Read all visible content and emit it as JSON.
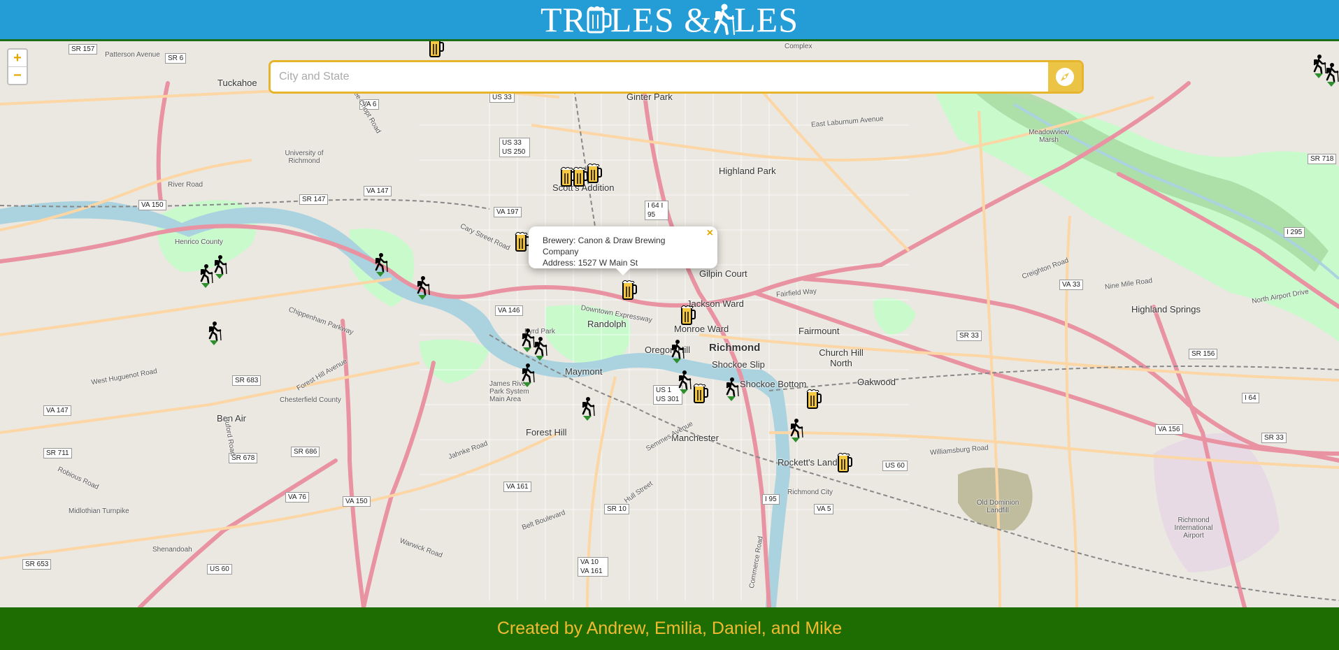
{
  "header": {
    "title_part1": "TR",
    "title_part2": "LES &",
    "title_part3": "LES"
  },
  "search": {
    "placeholder": "City and State",
    "button_icon": "compass-icon"
  },
  "zoom": {
    "in_label": "+",
    "out_label": "−"
  },
  "popup": {
    "line1": "Brewery: Canon & Draw Brewing Company",
    "line2": "Address: 1527 W Main St",
    "close_label": "×"
  },
  "map": {
    "place_labels": [
      {
        "name": "Tuckahoe",
        "style": "mid"
      },
      {
        "name": "University of Richmond",
        "style": "small"
      },
      {
        "name": "Ginter Park",
        "style": "mid"
      },
      {
        "name": "Highland Park",
        "style": "mid"
      },
      {
        "name": "Scott's Addition",
        "style": "mid"
      },
      {
        "name": "Gilpin Court",
        "style": "mid"
      },
      {
        "name": "Jackson Ward",
        "style": "mid"
      },
      {
        "name": "Monroe Ward",
        "style": "mid"
      },
      {
        "name": "Randolph",
        "style": "mid"
      },
      {
        "name": "Richmond",
        "style": "big"
      },
      {
        "name": "Shockoe Slip",
        "style": "mid"
      },
      {
        "name": "Shockoe Bottom",
        "style": "mid"
      },
      {
        "name": "Church Hill North",
        "style": "mid"
      },
      {
        "name": "Fairmount",
        "style": "mid"
      },
      {
        "name": "Oakwood",
        "style": "mid"
      },
      {
        "name": "Highland Springs",
        "style": "mid"
      },
      {
        "name": "Maymont",
        "style": "mid"
      },
      {
        "name": "Forest Hill",
        "style": "mid"
      },
      {
        "name": "Manchester",
        "style": "mid"
      },
      {
        "name": "Rockett's Landing",
        "style": "mid"
      },
      {
        "name": "Bon Air",
        "style": "mid"
      },
      {
        "name": "Oregon Hill",
        "style": "mid"
      },
      {
        "name": "Meadowview Marsh",
        "style": "small"
      },
      {
        "name": "Old Dominion Landfill",
        "style": "small"
      },
      {
        "name": "Richmond International Airport",
        "style": "small"
      },
      {
        "name": "Shenandoah",
        "style": "small"
      },
      {
        "name": "Byrd Park",
        "style": "small"
      },
      {
        "name": "James River Park System Main Area",
        "style": "small"
      },
      {
        "name": "Chesterfield County",
        "style": "small"
      },
      {
        "name": "Richmond City",
        "style": "small"
      },
      {
        "name": "Henrico County",
        "style": "small"
      },
      {
        "name": "Complex",
        "style": "small"
      }
    ],
    "shields": [
      "SR 157",
      "SR 6",
      "US 33",
      "VA 6",
      "US 33 US 250",
      "VA 147",
      "SR 147",
      "VA 150",
      "VA 197",
      "I 64 I 95",
      "VA 146",
      "US 1 US 301",
      "SR 683",
      "VA 147",
      "SR 711",
      "SR 678",
      "SR 686",
      "VA 76",
      "VA 150",
      "US 60",
      "SR 653",
      "VA 161",
      "SR 10",
      "VA 10 VA 161",
      "I 95",
      "VA 5",
      "US 60",
      "SR 33",
      "SR 156",
      "VA 33",
      "I 64",
      "VA 156",
      "SR 33",
      "I 295",
      "SR 718"
    ],
    "road_labels": [
      "Patterson Avenue",
      "River Road",
      "Three Chopt Road",
      "Cary Street Road",
      "Chippenham Parkway",
      "Forest Hill Avenue",
      "West Huguenot Road",
      "Midlothian Turnpike",
      "Jahnke Road",
      "Hull Street",
      "Semmes Avenue",
      "Downtown Expressway",
      "East Laburnum Avenue",
      "Fairfield Way",
      "Nine Mile Road",
      "Williamsburg Road",
      "Creighton Road",
      "North Airport Drive",
      "Commerce Road",
      "Warwick Road",
      "Belt Boulevard",
      "Buford Road",
      "Robious Road"
    ],
    "markers": [
      {
        "kind": "beer"
      },
      {
        "kind": "beer"
      },
      {
        "kind": "beer"
      },
      {
        "kind": "beer"
      },
      {
        "kind": "beer"
      },
      {
        "kind": "beer"
      },
      {
        "kind": "beer"
      },
      {
        "kind": "beer"
      },
      {
        "kind": "beer"
      },
      {
        "kind": "beer"
      },
      {
        "kind": "hiker"
      },
      {
        "kind": "hiker"
      },
      {
        "kind": "hiker"
      },
      {
        "kind": "hiker"
      },
      {
        "kind": "hiker"
      },
      {
        "kind": "hiker"
      },
      {
        "kind": "hiker"
      },
      {
        "kind": "hiker"
      },
      {
        "kind": "hiker"
      },
      {
        "kind": "hiker"
      },
      {
        "kind": "hiker"
      },
      {
        "kind": "hiker"
      },
      {
        "kind": "hiker"
      },
      {
        "kind": "hiker"
      },
      {
        "kind": "hiker"
      }
    ]
  },
  "footer": {
    "credits": "Created by Andrew, Emilia, Daniel, and Mike"
  },
  "colors": {
    "header_bg": "#249cd6",
    "footer_bg": "#1d6d02",
    "footer_text": "#f1ba2f",
    "search_border": "#e7b52b",
    "search_button": "#ecc445",
    "river": "#aad3df",
    "park": "#c8facc",
    "highway": "#e892a2"
  }
}
